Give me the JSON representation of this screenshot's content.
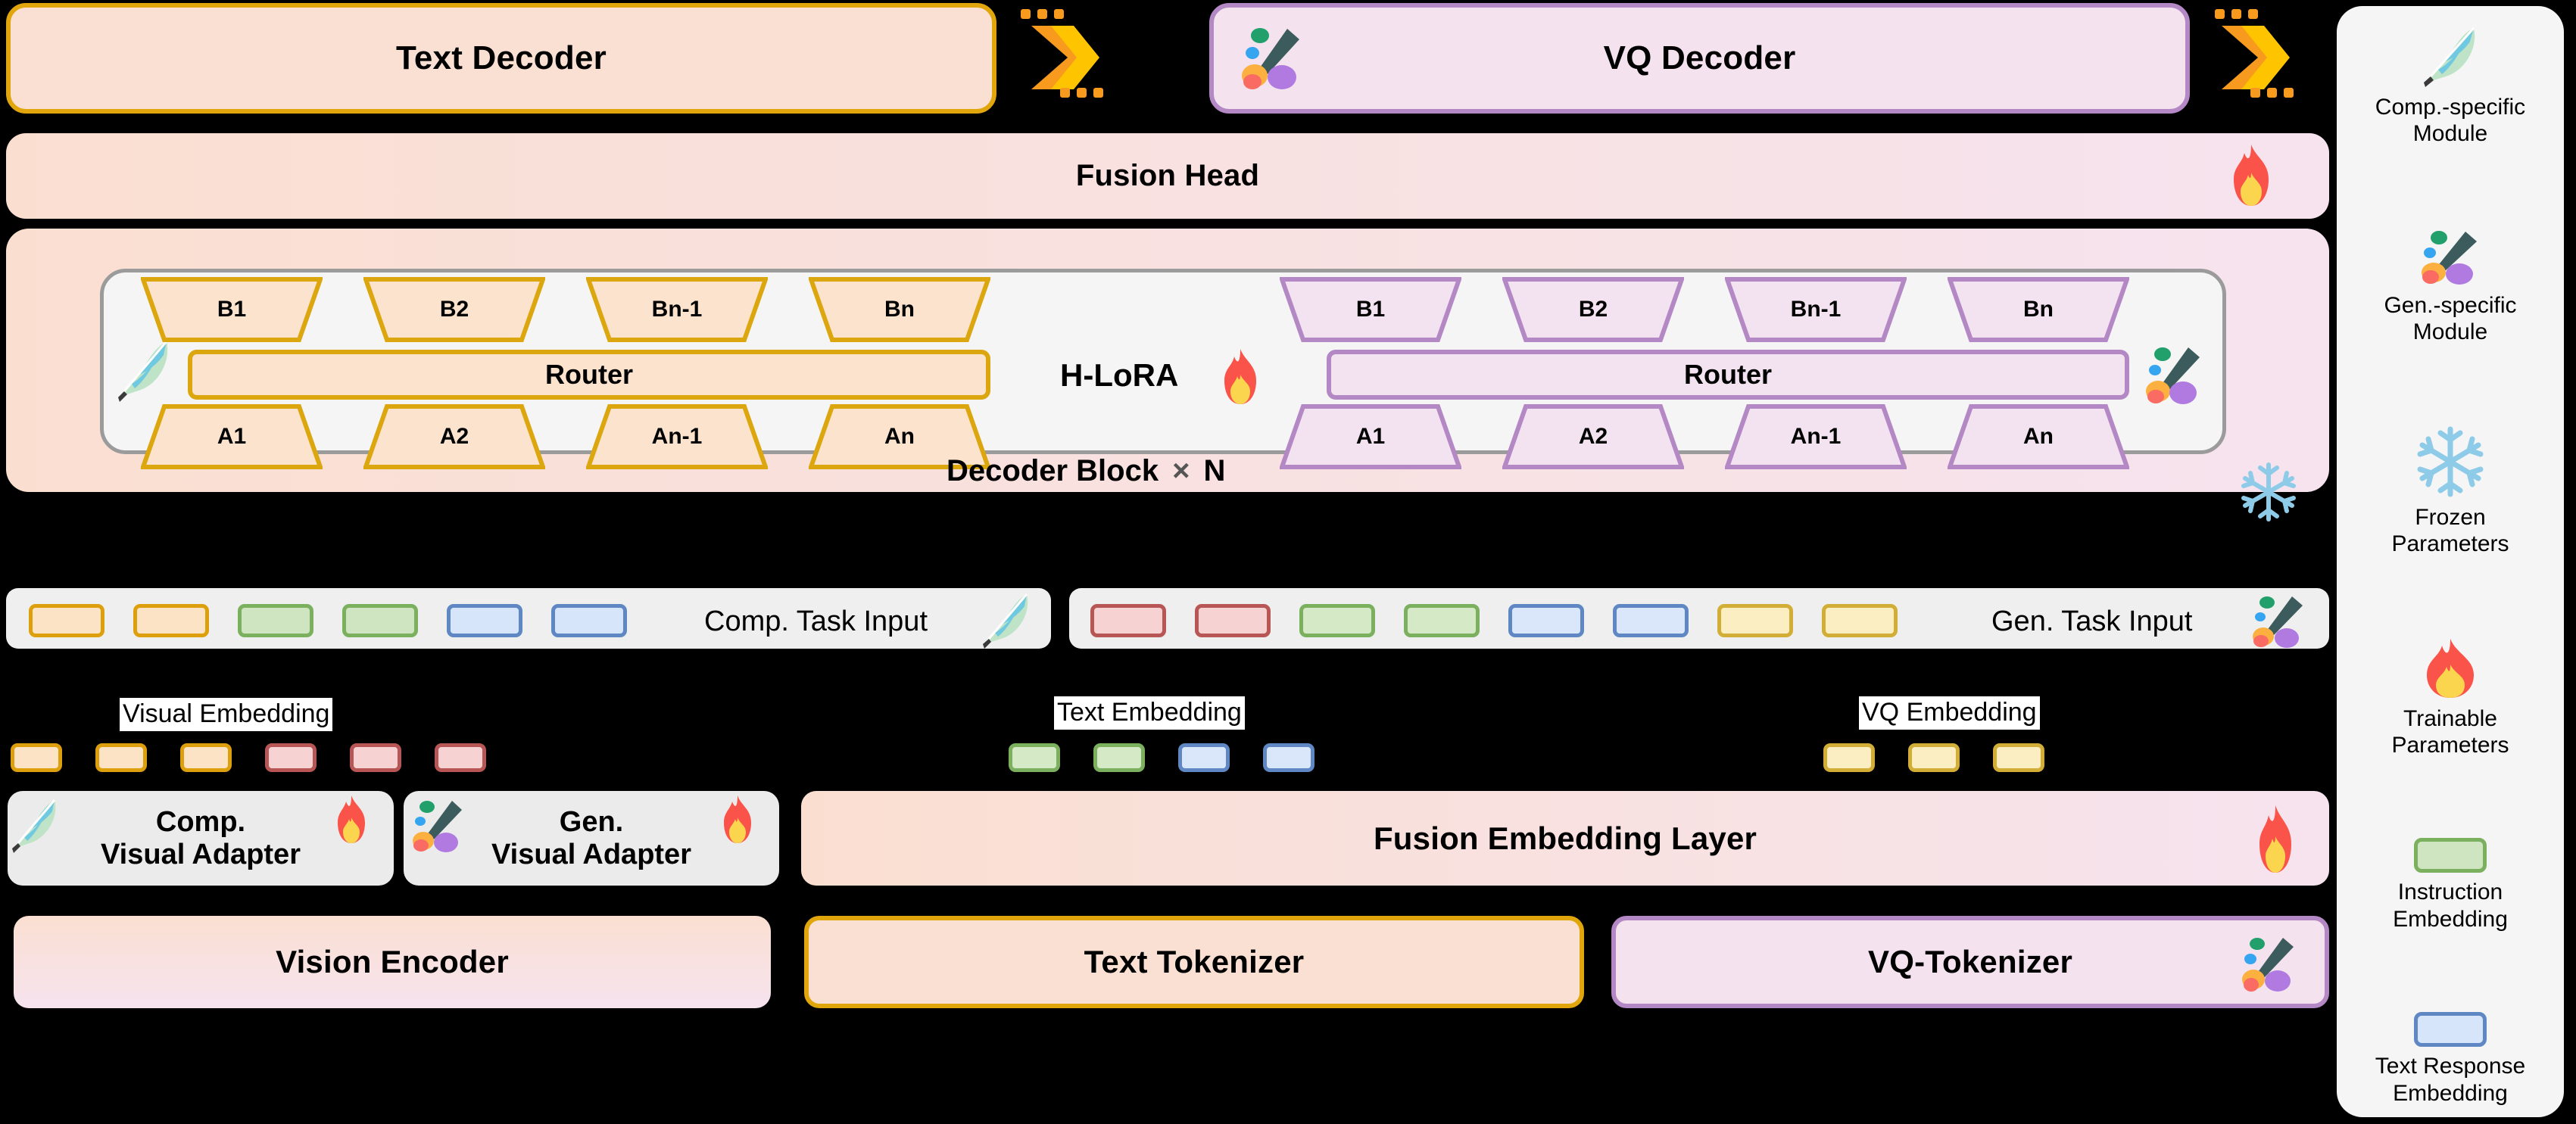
{
  "title": "H-LoRA Multimodal Architecture Diagram",
  "top_row": {
    "text_decoder": {
      "label": "Text Decoder",
      "fill": "#fae0d2",
      "border": "#e0a60c"
    },
    "vq_decoder": {
      "label": "VQ Decoder",
      "fill": "#f4e2ef",
      "border": "#b388c4",
      "icon": "paintbrush-icon"
    },
    "arrow_icon": "chevron-right-icon",
    "arrow_color": "#ffc400"
  },
  "fusion_head": {
    "label": "Fusion Head",
    "icon": "fire-icon"
  },
  "decoder_block": {
    "caption": "Decoder Block",
    "times_symbol": "×",
    "count": "N",
    "hlora_label": "H-LoRA",
    "hlora_icon": "fire-icon",
    "frozen_icon": "snowflake-icon",
    "comp_icon": "feather-icon",
    "gen_icon": "paintbrush-icon",
    "comp_side": {
      "top_experts": [
        "B1",
        "B2",
        "Bn-1",
        "Bn"
      ],
      "router_label": "Router",
      "bottom_experts": [
        "A1",
        "A2",
        "An-1",
        "An"
      ],
      "fill": "#fce3cd",
      "border": "#dca60f"
    },
    "gen_side": {
      "top_experts": [
        "B1",
        "B2",
        "Bn-1",
        "Bn"
      ],
      "router_label": "Router",
      "bottom_experts": [
        "A1",
        "A2",
        "An-1",
        "An"
      ],
      "fill": "#f3e3f1",
      "border": "#b388c4"
    }
  },
  "task_inputs": {
    "comp": {
      "label": "Comp. Task Input",
      "icon": "feather-icon",
      "tokens": [
        {
          "fill": "#fde3c6",
          "border": "#dda00c"
        },
        {
          "fill": "#fde3c6",
          "border": "#dda00c"
        },
        {
          "fill": "#cfe5c1",
          "border": "#7ab05e"
        },
        {
          "fill": "#cfe5c1",
          "border": "#7ab05e"
        },
        {
          "fill": "#d6e5fa",
          "border": "#5f87c4"
        },
        {
          "fill": "#d6e5fa",
          "border": "#5f87c4"
        }
      ]
    },
    "gen": {
      "label": "Gen. Task Input",
      "icon": "paintbrush-icon",
      "tokens": [
        {
          "fill": "#f6d2d2",
          "border": "#b85656"
        },
        {
          "fill": "#f6d2d2",
          "border": "#b85656"
        },
        {
          "fill": "#d5e9c7",
          "border": "#7ab05e"
        },
        {
          "fill": "#d5e9c7",
          "border": "#7ab05e"
        },
        {
          "fill": "#dae7fb",
          "border": "#5f87c4"
        },
        {
          "fill": "#dae7fb",
          "border": "#5f87c4"
        },
        {
          "fill": "#fbeec2",
          "border": "#d3ae37"
        },
        {
          "fill": "#fbeec2",
          "border": "#d3ae37"
        }
      ]
    }
  },
  "embeddings": {
    "visual": {
      "caption": "Visual Embedding",
      "tokens": [
        {
          "fill": "#fde3c6",
          "border": "#dda00c"
        },
        {
          "fill": "#fde3c6",
          "border": "#dda00c"
        },
        {
          "fill": "#fde3c6",
          "border": "#dda00c"
        },
        {
          "fill": "#f6d2d2",
          "border": "#b85656"
        },
        {
          "fill": "#f6d2d2",
          "border": "#b85656"
        },
        {
          "fill": "#f6d2d2",
          "border": "#b85656"
        }
      ]
    },
    "text": {
      "caption": "Text Embedding",
      "tokens": [
        {
          "fill": "#d5e9c7",
          "border": "#7ab05e"
        },
        {
          "fill": "#d5e9c7",
          "border": "#7ab05e"
        },
        {
          "fill": "#dae7fb",
          "border": "#5f87c4"
        },
        {
          "fill": "#dae7fb",
          "border": "#5f87c4"
        }
      ]
    },
    "vq": {
      "caption": "VQ Embedding",
      "tokens": [
        {
          "fill": "#fbeec2",
          "border": "#d3ae37"
        },
        {
          "fill": "#fbeec2",
          "border": "#d3ae37"
        },
        {
          "fill": "#fbeec2",
          "border": "#d3ae37"
        }
      ]
    }
  },
  "adapters": {
    "comp": {
      "line1": "Comp.",
      "line2": "Visual Adapter",
      "icon": "feather-icon",
      "train_icon": "fire-icon"
    },
    "gen": {
      "line1": "Gen.",
      "line2": "Visual Adapter",
      "icon": "paintbrush-icon",
      "train_icon": "fire-icon"
    },
    "fusion_embedding": {
      "label": "Fusion Embedding Layer",
      "train_icon": "fire-icon"
    }
  },
  "bottom_row": {
    "vision_encoder": {
      "label": "Vision Encoder"
    },
    "text_tokenizer": {
      "label": "Text Tokenizer",
      "border": "#e0a60c"
    },
    "vq_tokenizer": {
      "label": "VQ-Tokenizer",
      "border": "#b388c4",
      "icon": "paintbrush-icon"
    }
  },
  "legend": {
    "items": [
      {
        "icon": "feather-icon",
        "line1": "Comp.-specific",
        "line2": "Module"
      },
      {
        "icon": "paintbrush-icon",
        "line1": "Gen.-specific",
        "line2": "Module"
      },
      {
        "icon": "snowflake-icon",
        "line1": "Frozen",
        "line2": "Parameters"
      },
      {
        "icon": "fire-icon",
        "line1": "Trainable",
        "line2": "Parameters"
      },
      {
        "icon": "green-chip-swatch",
        "line1": "Instruction",
        "line2": "Embedding",
        "fill": "#cfe5c1",
        "border": "#7ab05e"
      },
      {
        "icon": "blue-chip-swatch",
        "line1": "Text Response",
        "line2": "Embedding",
        "fill": "#d6e5fa",
        "border": "#5f87c4"
      }
    ]
  },
  "colors": {
    "peach": "#fae0d2",
    "pink": "#f4e2ef",
    "grey_panel": "#efefef",
    "orange_border": "#e0a60c",
    "purple_border": "#b388c4",
    "arrow_yellow": "#ffc400",
    "arrow_orange": "#f79a1e",
    "fire_red": "#f9534a",
    "fire_yellow": "#fcd54f",
    "snow_blue": "#8dcbe8"
  }
}
